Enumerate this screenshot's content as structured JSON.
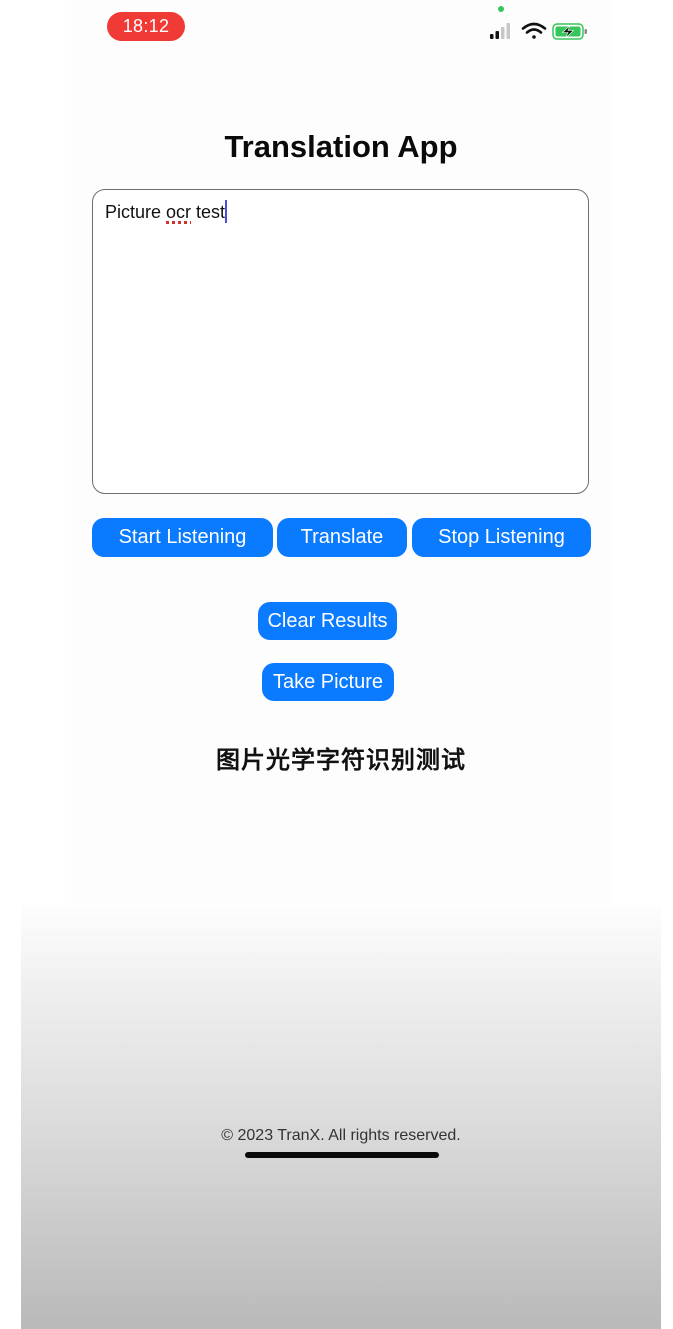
{
  "status_bar": {
    "time": "18:12",
    "icons": [
      "signal-icon",
      "wifi-icon",
      "battery-charging-icon"
    ],
    "time_pill_color": "#f03a35",
    "privacy_dot_color": "#34c759",
    "battery_color": "#34c759",
    "battery_charging": true
  },
  "app": {
    "title": "Translation App"
  },
  "input": {
    "value_before": "Picture ",
    "misspelled_word": "ocr",
    "value_after": " test",
    "spellcheck_flagged": true
  },
  "buttons": {
    "start_listening": "Start Listening",
    "translate": "Translate",
    "stop_listening": "Stop Listening",
    "clear_results": "Clear Results",
    "take_picture": "Take Picture"
  },
  "result": {
    "text": "图片光学字符识别测试"
  },
  "footer": {
    "copyright": "© 2023 TranX. All rights reserved."
  },
  "colors": {
    "accent": "#0a7aff",
    "text": "#111111"
  }
}
